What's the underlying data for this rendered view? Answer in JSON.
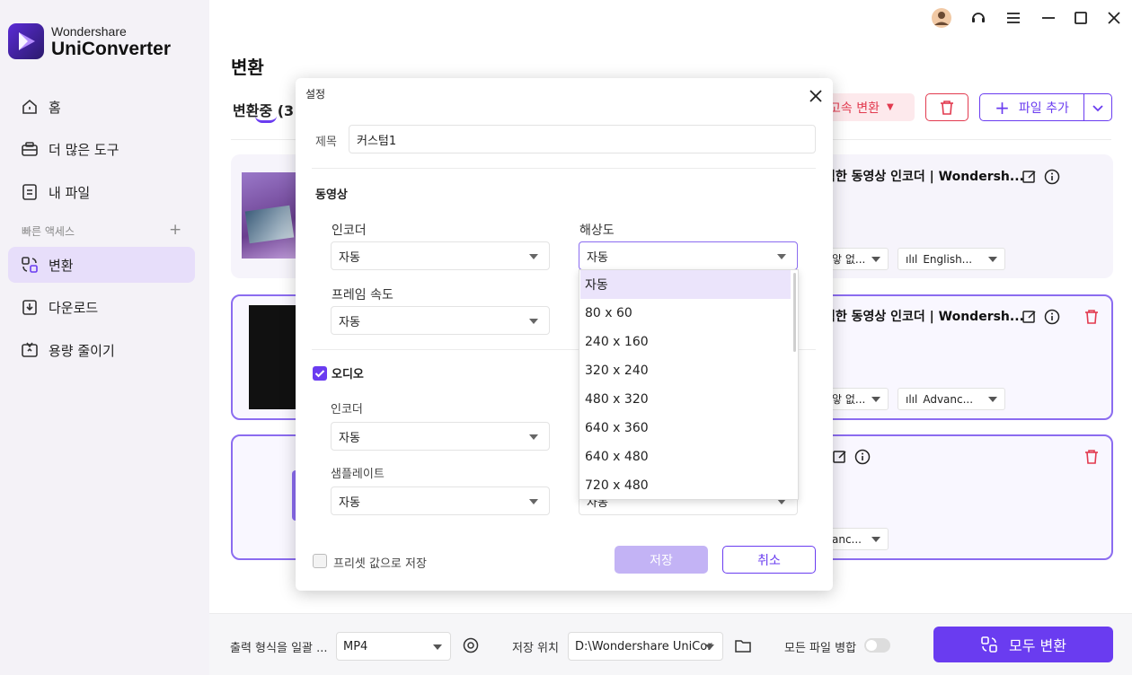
{
  "app": {
    "brand": "Wondershare",
    "product": "UniConverter"
  },
  "sidebar": {
    "items": [
      {
        "label": "홈"
      },
      {
        "label": "더 많은 도구"
      },
      {
        "label": "내 파일"
      },
      {
        "label": "변환"
      },
      {
        "label": "다운로드"
      },
      {
        "label": "용량 줄이기"
      }
    ],
    "quick_access": "빠른 액세스",
    "quick_plus": "+"
  },
  "main": {
    "title": "변환",
    "tab_converting": "변환중 (3",
    "fast_convert": "고속 변환",
    "add_file": "파일 추가"
  },
  "cards": [
    {
      "title": "벽한 동영상 인코더 | Wondersh...",
      "audio_left": "앟 없...",
      "audio_right": "English..."
    },
    {
      "title": "벽한 동영상 인코더 | Wondersh...",
      "audio_left": "앟 없...",
      "audio_right": "Advanc..."
    },
    {
      "audio_left": "anc..."
    }
  ],
  "bottom": {
    "output_label": "출력 형식을 일괄 ...",
    "output_format": "MP4",
    "save_label": "저장 위치",
    "save_path": "D:\\Wondershare UniCor",
    "merge_label": "모든 파일 병합",
    "convert_all": "모두 변환"
  },
  "dialog": {
    "title": "설정",
    "name_label": "제목",
    "name_value": "커스텀1",
    "video_section": "동영상",
    "video_encoder_label": "인코더",
    "video_encoder_value": "자동",
    "resolution_label": "해상도",
    "resolution_value": "자동",
    "framerate_label": "프레임 속도",
    "framerate_value": "자동",
    "audio_section": "오디오",
    "audio_encoder_label": "인코더",
    "audio_encoder_value": "자동",
    "samplerate_label": "샘플레이트",
    "samplerate_value": "자동",
    "hidden_right_value": "자동",
    "preset_label": "프리셋 값으로 저장",
    "save": "저장",
    "cancel": "취소"
  },
  "resolution_options": [
    "자동",
    "80 x 60",
    "240 x 160",
    "320 x 240",
    "480 x 320",
    "640 x 360",
    "640 x 480",
    "720 x 480"
  ],
  "colors": {
    "accent": "#6a3cf0",
    "danger": "#e23a4f",
    "active_nav": "#e7defa"
  }
}
